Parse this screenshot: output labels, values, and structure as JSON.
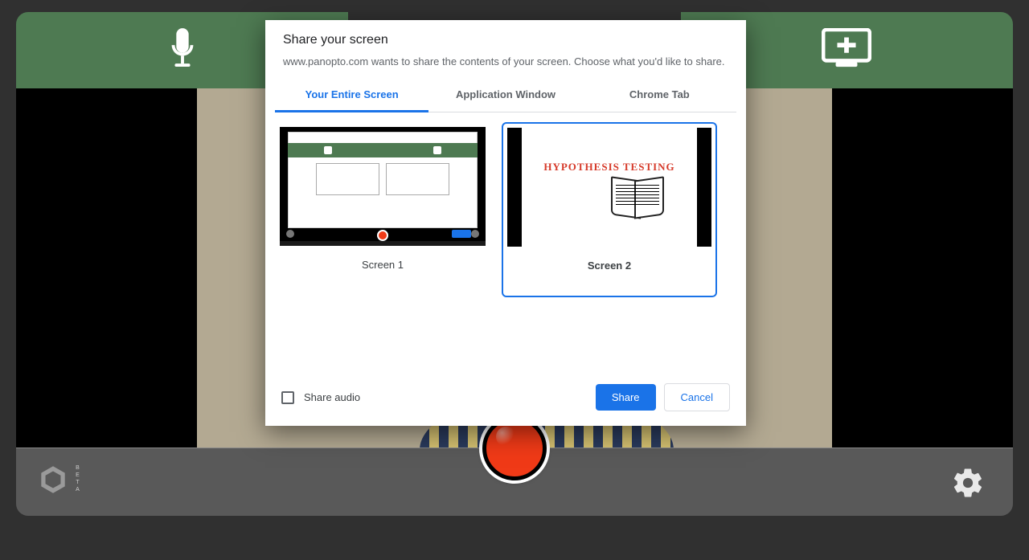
{
  "recorder": {
    "beta_label": "BETA"
  },
  "modal": {
    "title": "Share your screen",
    "subtitle": "www.panopto.com wants to share the contents of your screen. Choose what you'd like to share.",
    "tabs": {
      "entire_screen": "Your Entire Screen",
      "app_window": "Application Window",
      "chrome_tab": "Chrome Tab"
    },
    "thumbs": {
      "screen1_label": "Screen 1",
      "screen2_label": "Screen 2",
      "screen2_slide_title": "HYPOTHESIS TESTING"
    },
    "share_audio_label": "Share audio",
    "share_button": "Share",
    "cancel_button": "Cancel"
  }
}
